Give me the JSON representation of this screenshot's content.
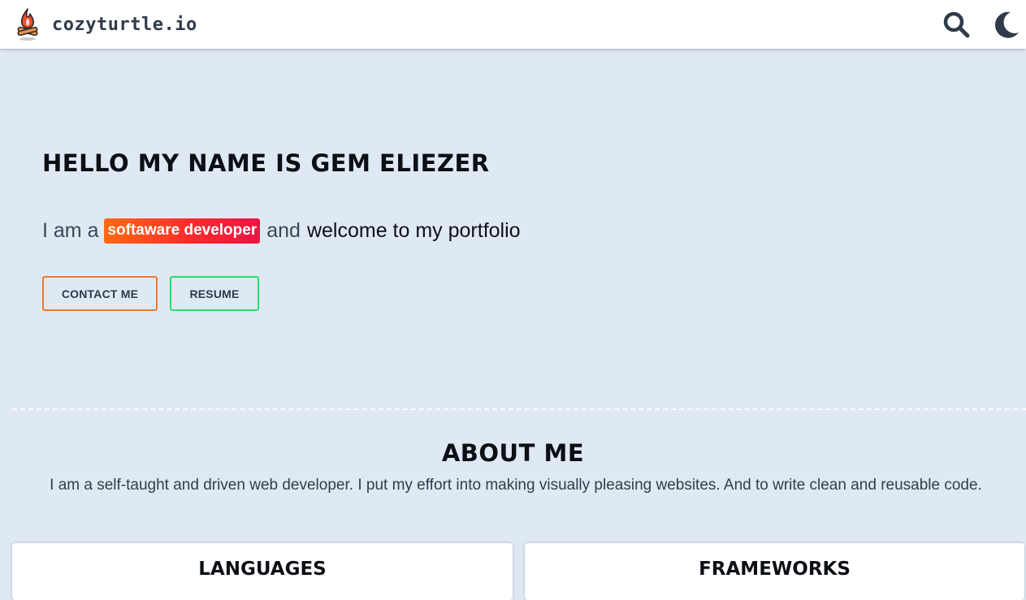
{
  "header": {
    "brand_name": "cozyturtle.io",
    "logo_icon": "campfire-icon",
    "search_icon": "search-icon",
    "theme_icon": "moon-icon"
  },
  "hero": {
    "title": "Hello my name is Gem Eliezer",
    "subtitle_prefix": "I am a",
    "highlight": "softaware developer",
    "subtitle_and": "and",
    "subtitle_suffix": "welcome to my portfolio",
    "contact_label": "CONTACT ME",
    "resume_label": "RESUME"
  },
  "about": {
    "title": "About me",
    "text": "I am a self-taught and driven web developer. I put my effort into making visually pleasing websites. And to write clean and reusable code."
  },
  "skills": {
    "languages_title": "Languages",
    "frameworks_title": "Frameworks"
  },
  "colors": {
    "page_background": "#dfe9f4",
    "header_background": "#ffffff",
    "contact_border": "#ee7a2c",
    "resume_border": "#25e06c",
    "highlight_gradient_start": "#ff6a13",
    "highlight_gradient_end": "#ef1346",
    "icon_color": "#2f3b4b"
  }
}
